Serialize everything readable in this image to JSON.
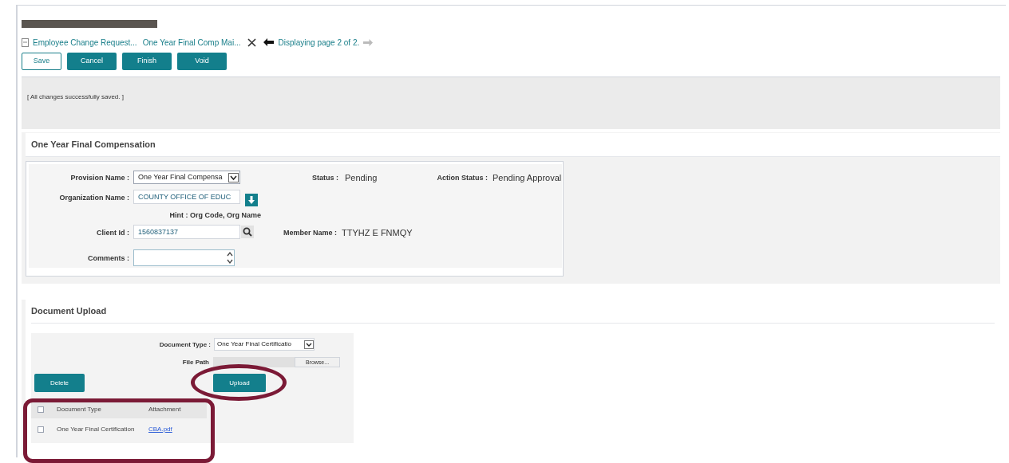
{
  "breadcrumb": {
    "items": [
      {
        "label": "Employee Change Request..."
      },
      {
        "label": "One Year Final Comp Mai..."
      }
    ],
    "paging": "Displaying page 2 of 2."
  },
  "buttons": [
    {
      "label": "Save",
      "kind": "outline"
    },
    {
      "label": "Cancel",
      "kind": "primary"
    },
    {
      "label": "Finish",
      "kind": "primary"
    },
    {
      "label": "Void",
      "kind": "primary"
    }
  ],
  "message": "[ All changes successfully saved. ]",
  "compensation": {
    "title": "One Year Final Compensation",
    "provision": {
      "label": "Provision Name :",
      "value": "One Year Final Compensa"
    },
    "status": {
      "label": "Status :",
      "value": "Pending"
    },
    "action_status": {
      "label": "Action Status :",
      "value": "Pending Approval"
    },
    "organization": {
      "label": "Organization Name :",
      "value": "COUNTY OFFICE OF EDUC",
      "hint": "Hint : Org Code, Org Name"
    },
    "client_id": {
      "label": "Client Id :",
      "value": "1560837137"
    },
    "member_name": {
      "label": "Member Name :",
      "value": "TTYHZ E FNMQY"
    },
    "comments": {
      "label": "Comments :"
    }
  },
  "upload": {
    "title": "Document Upload",
    "document_type": {
      "label": "Document Type :",
      "value": "One Year Final Certificatio"
    },
    "file_path": {
      "label": "File Path",
      "browse": "Browse..."
    },
    "delete": "Delete",
    "upload_button": {
      "label": "Upload",
      "highlighted": true
    },
    "table": {
      "highlighted": true,
      "select_all": {
        "checked": false
      },
      "columns": [
        "Document Type",
        "Attachment"
      ],
      "rows": [
        {
          "checked": false,
          "document_type": "One Year Final Certification",
          "attachment": "CBA.pdf"
        }
      ]
    }
  }
}
